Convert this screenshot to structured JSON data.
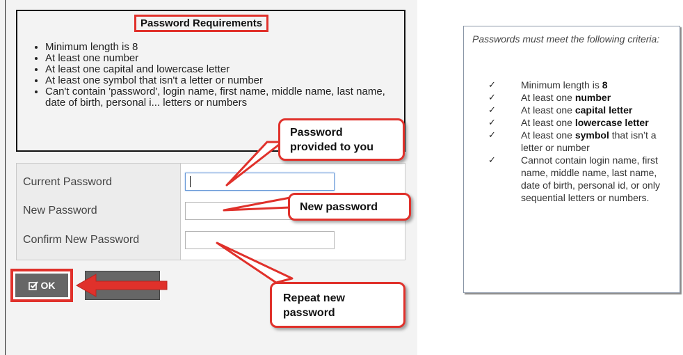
{
  "requirements": {
    "title": "Password Requirements",
    "items": [
      "Minimum length is 8",
      "At least one number",
      "At least one capital and lowercase letter",
      "At least one symbol that isn't a letter or number",
      "Can't contain 'password', login name, first name, middle name, last name, date of birth, personal i... letters or numbers"
    ]
  },
  "form": {
    "current_label": "Current Password",
    "new_label": "New Password",
    "confirm_label": "Confirm New Password",
    "current_value": "",
    "new_value": "",
    "confirm_value": ""
  },
  "buttons": {
    "ok_label": "OK",
    "cancel_label": ""
  },
  "callouts": {
    "provided_line1": "Password",
    "provided_line2": "provided to you",
    "new": "New password",
    "repeat_line1": "Repeat new",
    "repeat_line2": "password"
  },
  "criteria": {
    "intro": "Passwords must meet the following criteria:",
    "items": [
      {
        "pre": "Minimum length is ",
        "bold": "8",
        "post": ""
      },
      {
        "pre": "At least one ",
        "bold": "number",
        "post": ""
      },
      {
        "pre": "At least one ",
        "bold": "capital letter",
        "post": ""
      },
      {
        "pre": "At least one ",
        "bold": "lowercase letter",
        "post": ""
      },
      {
        "pre": "At least one ",
        "bold": "symbol",
        "post": " that isn’t a letter or number"
      },
      {
        "pre": "Cannot contain login name, first name, middle name, last name, date of birth, personal id, or only sequential letters or numbers.",
        "bold": "",
        "post": ""
      }
    ]
  },
  "colors": {
    "highlight_red": "#e0312b",
    "button_gray": "#666666",
    "focus_blue": "#6a9ad8"
  },
  "icons": {
    "ok": "checkbox-icon",
    "criteria_bullet": "checkmark-icon"
  }
}
